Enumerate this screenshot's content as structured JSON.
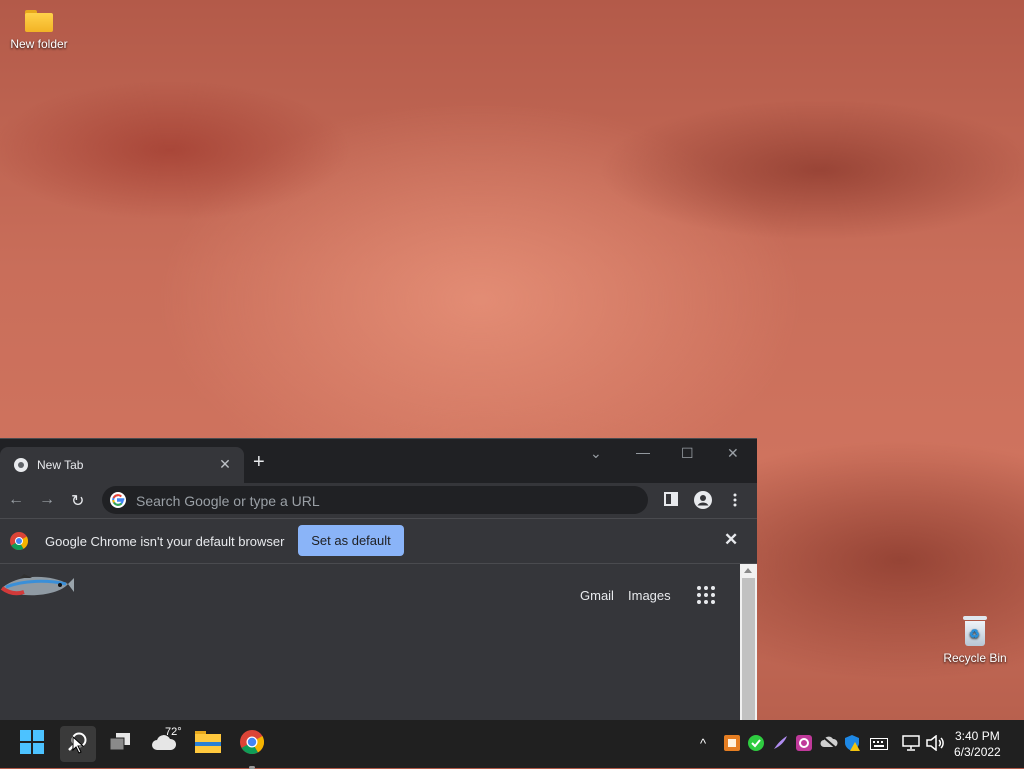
{
  "desktop": {
    "icons": [
      {
        "label": "New folder",
        "icon": "folder-icon"
      },
      {
        "label": "Recycle Bin",
        "icon": "recycle-bin-icon"
      }
    ]
  },
  "browser": {
    "tab": {
      "title": "New Tab",
      "close_label": "✕"
    },
    "new_tab_label": "+",
    "window_controls": {
      "dropdown": "⌄",
      "minimize": "—",
      "maximize": "☐",
      "close": "✕"
    },
    "nav": {
      "back": "←",
      "forward": "→",
      "reload": "↻"
    },
    "omnibox": {
      "placeholder": "Search Google or type a URL",
      "value": ""
    },
    "infobar": {
      "message": "Google Chrome isn't your default browser",
      "button_label": "Set as default",
      "close_label": "✕"
    },
    "ntp": {
      "gmail_label": "Gmail",
      "images_label": "Images"
    }
  },
  "taskbar": {
    "weather_temp": "72°",
    "apps": [
      "start-icon",
      "search-icon",
      "task-view-icon",
      "weather-icon",
      "file-explorer-icon",
      "chrome-icon"
    ],
    "tray_chevron": "^",
    "clock": {
      "time": "3:40 PM",
      "date": "6/3/2022"
    }
  },
  "colors": {
    "accent_button": "#8ab4f8",
    "chrome_dark": "#35363a",
    "tabstrip": "#202124",
    "taskbar": "#202020"
  }
}
